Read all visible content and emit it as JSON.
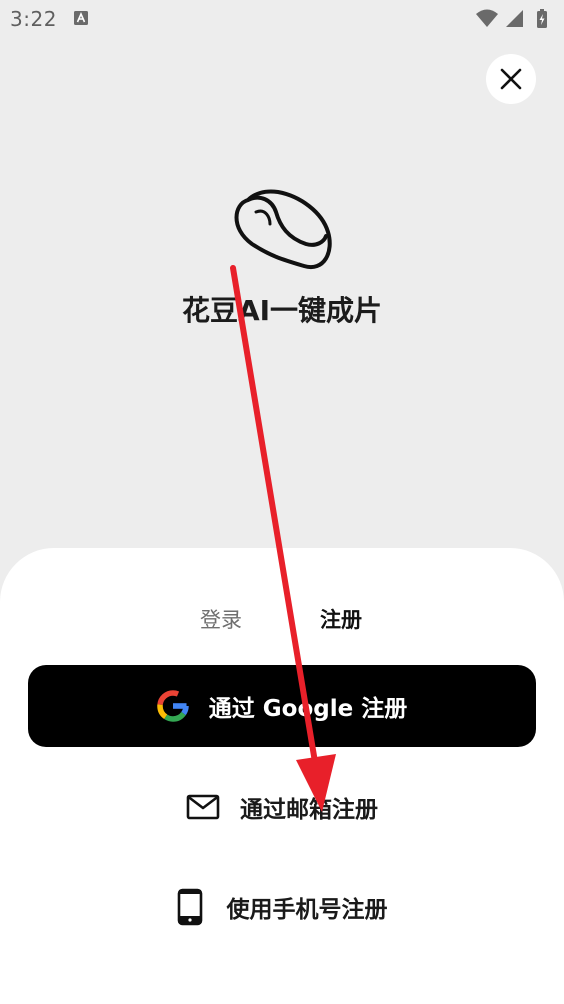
{
  "status_bar": {
    "time": "3:22",
    "notification_icon": "a-letter-icon",
    "wifi_icon": "wifi-icon",
    "signal_icon": "signal-icon",
    "battery_icon": "battery-charging-icon"
  },
  "close_button": {
    "icon": "close-icon"
  },
  "app": {
    "logo_icon": "coffee-bean-logo",
    "title": "花豆AI一键成片"
  },
  "tabs": [
    {
      "label": "登录",
      "selected": false
    },
    {
      "label": "注册",
      "selected": true
    }
  ],
  "options": {
    "google": {
      "label": "通过 Google 注册",
      "icon": "google-icon"
    },
    "email": {
      "label": "通过邮箱注册",
      "icon": "mail-icon"
    },
    "phone": {
      "label": "使用手机号注册",
      "icon": "phone-icon"
    }
  },
  "colors": {
    "background": "#ededed",
    "sheet": "#ffffff",
    "primary_button": "#000000",
    "annotation_arrow": "#e8202a"
  }
}
